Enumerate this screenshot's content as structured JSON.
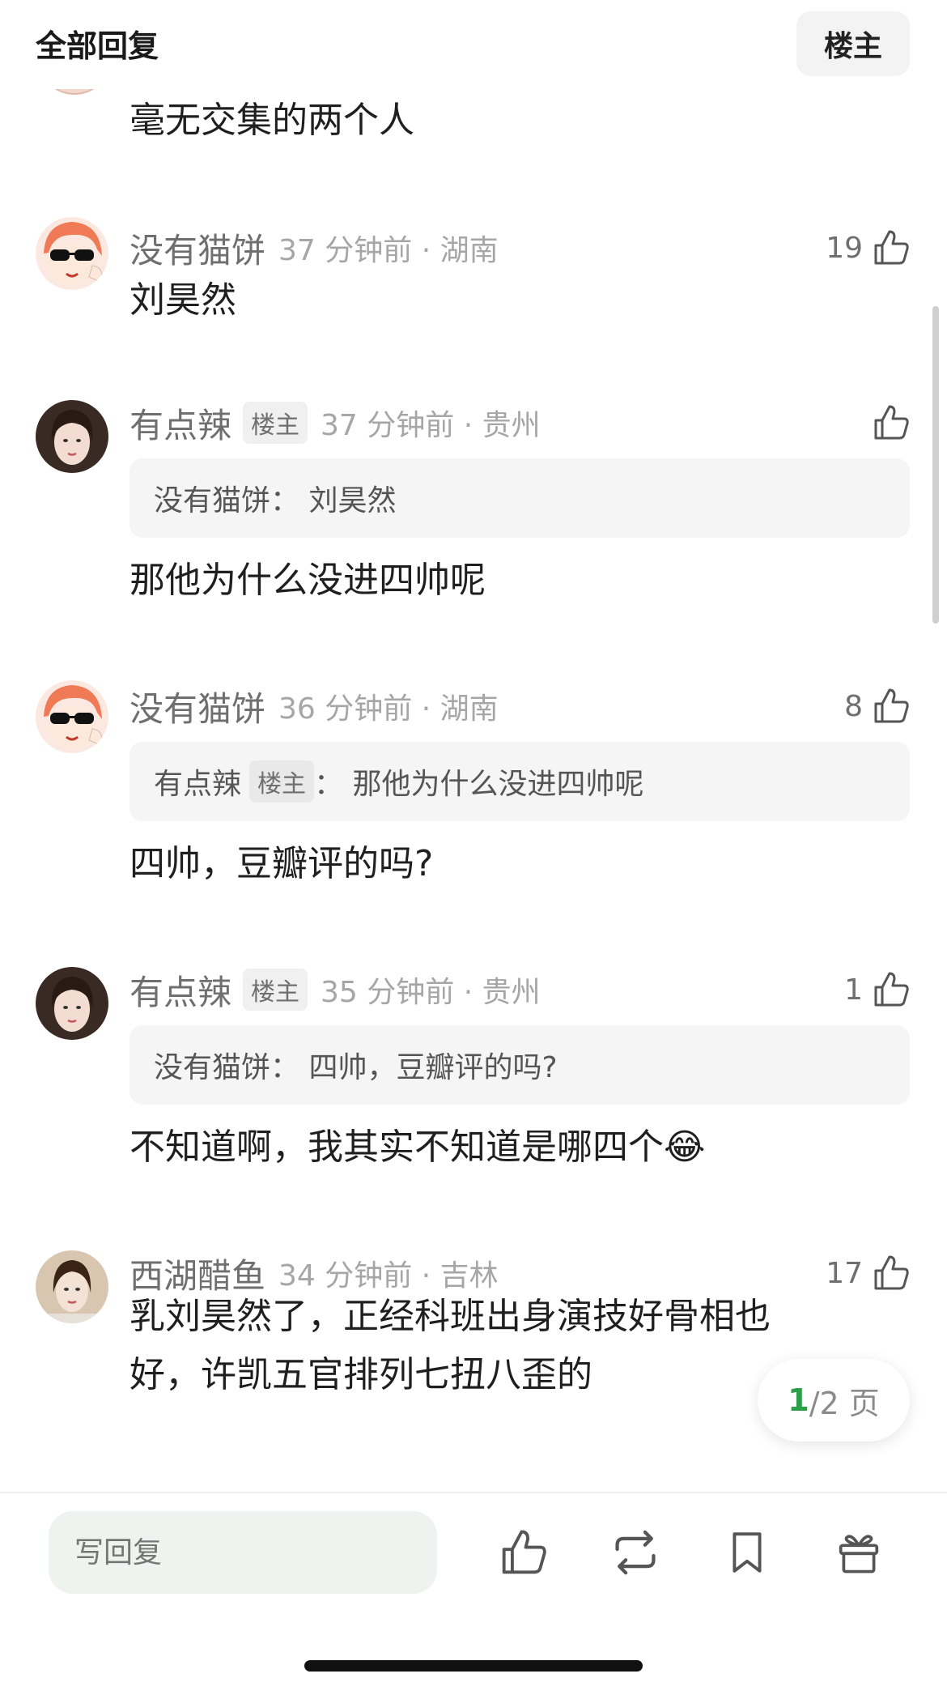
{
  "header": {
    "title": "全部回复",
    "op_filter_label": "楼主"
  },
  "partial_comment": {
    "text": "毫无交集的两个人"
  },
  "comments": [
    {
      "name": "没有猫饼",
      "is_op": false,
      "time_location": "37 分钟前 · 湖南",
      "likes": "19",
      "quote": null,
      "text": "刘昊然"
    },
    {
      "name": "有点辣",
      "is_op": true,
      "op_badge": "楼主",
      "time_location": "37 分钟前 · 贵州",
      "likes": "",
      "quote": {
        "name": "没有猫饼",
        "badge": "",
        "text": "：  刘昊然"
      },
      "text": "那他为什么没进四帅呢"
    },
    {
      "name": "没有猫饼",
      "is_op": false,
      "time_location": "36 分钟前 · 湖南",
      "likes": "8",
      "quote": {
        "name": "有点辣",
        "badge": "楼主",
        "text": "：  那他为什么没进四帅呢"
      },
      "text": "四帅，豆瓣评的吗?"
    },
    {
      "name": "有点辣",
      "is_op": true,
      "op_badge": "楼主",
      "time_location": "35 分钟前 · 贵州",
      "likes": "1",
      "quote": {
        "name": "没有猫饼",
        "badge": "",
        "text": "：  四帅，豆瓣评的吗?"
      },
      "text": "不知道啊，我其实不知道是哪四个",
      "emoji": "😂"
    },
    {
      "name": "西湖醋鱼",
      "is_op": false,
      "time_location": "34 分钟前 · 吉林",
      "likes": "17",
      "quote": null,
      "text_line1": "乳刘昊然了，正经科班出身演技好骨相也",
      "text_line2": "好，许凯五官排列七扭八歪的"
    }
  ],
  "page_indicator": {
    "current": "1",
    "total": "/2 页"
  },
  "bottom_bar": {
    "reply_placeholder": "写回复"
  },
  "icons": {
    "like": "thumb-up-icon",
    "repost": "repost-icon",
    "bookmark": "bookmark-icon",
    "gift": "gift-icon"
  },
  "colors": {
    "accent_green": "#2e9e4a",
    "meta_gray": "#a6a6a6",
    "quote_bg": "#f5f5f5",
    "input_bg": "#eef3ef"
  }
}
